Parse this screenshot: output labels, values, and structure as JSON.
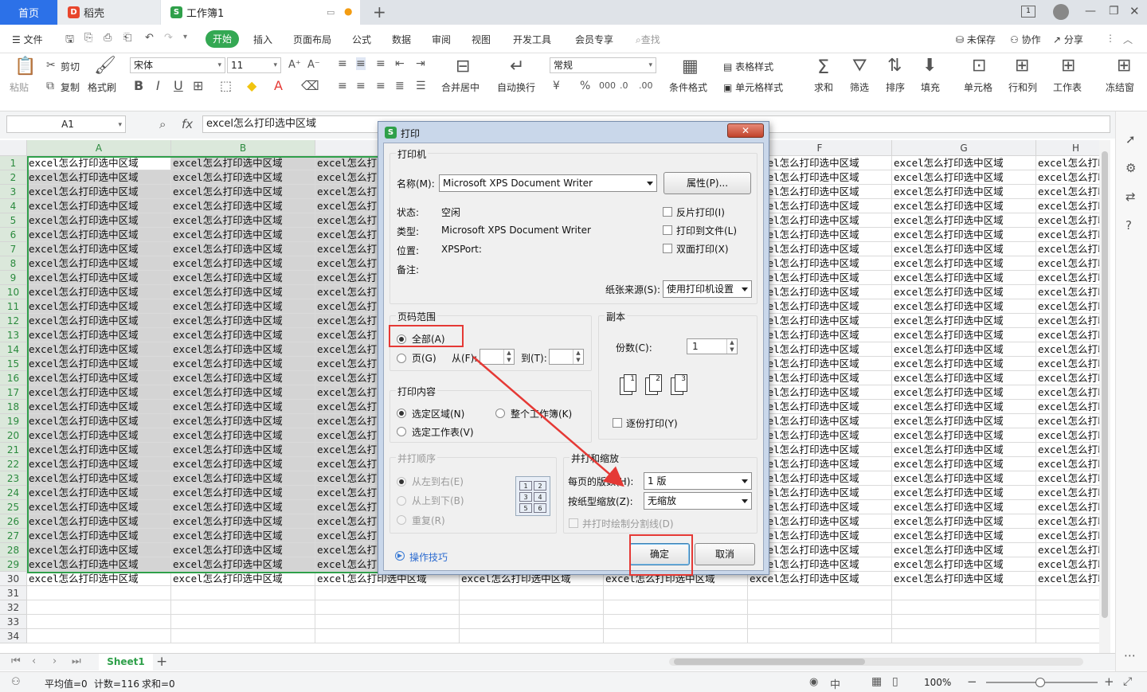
{
  "tabs": {
    "home": "首页",
    "docer": "稻壳",
    "workbook": "工作簿1"
  },
  "menu": {
    "file": "文件",
    "items": [
      "开始",
      "插入",
      "页面布局",
      "公式",
      "数据",
      "审阅",
      "视图",
      "开发工具",
      "会员专享"
    ],
    "search": "查找",
    "unsaved": "未保存",
    "collab": "协作",
    "share": "分享"
  },
  "toolbar": {
    "paste": "粘贴",
    "cut": "剪切",
    "copy": "复制",
    "format_painter": "格式刷",
    "font_name": "宋体",
    "font_size": "11",
    "merge_center": "合并居中",
    "wrap": "自动换行",
    "number_format": "常规",
    "cond_format": "条件格式",
    "table_style": "表格样式",
    "cell_style": "单元格样式",
    "sum": "求和",
    "filter": "筛选",
    "sort": "排序",
    "fill": "填充",
    "cell": "单元格",
    "rowcol": "行和列",
    "worksheet": "工作表",
    "freeze": "冻结窗"
  },
  "formula": {
    "cell_ref": "A1",
    "fx": "fx",
    "content": "excel怎么打印选中区域"
  },
  "grid": {
    "columns": [
      "A",
      "B",
      "C",
      "D",
      "E",
      "F",
      "G",
      "H"
    ],
    "selected_columns": [
      "A",
      "B"
    ],
    "cell_text": "excel怎么打印选中区域",
    "rows": [
      1,
      2,
      3,
      4,
      5,
      6,
      7,
      8,
      9,
      10,
      11,
      12,
      13,
      14,
      15,
      16,
      17,
      18,
      19,
      20,
      21,
      22,
      23,
      24,
      25,
      26,
      27,
      28,
      29,
      30,
      31,
      32,
      33,
      34
    ],
    "filled_rows": 30,
    "selected_rows": 29
  },
  "sheets": {
    "active": "Sheet1"
  },
  "status": {
    "avg": "平均值=0",
    "count": "计数=116",
    "sum": "求和=0",
    "zoom": "100%"
  },
  "dialog": {
    "title": "打印",
    "printer_group": "打印机",
    "name_label": "名称(M):",
    "printer_name": "Microsoft XPS Document Writer",
    "properties_btn": "属性(P)...",
    "status_label": "状态:",
    "status_value": "空闲",
    "type_label": "类型:",
    "type_value": "Microsoft XPS Document Writer",
    "where_label": "位置:",
    "where_value": "XPSPort:",
    "comment_label": "备注:",
    "reverse": "反片打印(I)",
    "to_file": "打印到文件(L)",
    "duplex": "双面打印(X)",
    "paper_source_label": "纸张来源(S):",
    "paper_source": "使用打印机设置",
    "range_group": "页码范围",
    "all": "全部(A)",
    "pages": "页(G)",
    "from": "从(F):",
    "to": "到(T):",
    "copies_group": "副本",
    "copies_label": "份数(C):",
    "copies": "1",
    "collate": "逐份打印(Y)",
    "content_group": "打印内容",
    "sel_area": "选定区域(N)",
    "whole_book": "整个工作簿(K)",
    "sel_sheet": "选定工作表(V)",
    "order_group": "并打顺序",
    "lr": "从左到右(E)",
    "tb": "从上到下(B)",
    "repeat": "重复(R)",
    "scale_group": "并打和缩放",
    "pps_label": "每页的版数(H):",
    "pps": "1 版",
    "scale_label": "按纸型缩放(Z):",
    "scale": "无缩放",
    "draw_lines": "并打时绘制分割线(D)",
    "tips": "操作技巧",
    "ok": "确定",
    "cancel": "取消"
  },
  "colors": {
    "accent": "#2c71e8",
    "green": "#34a853",
    "highlight": "#e53935"
  }
}
